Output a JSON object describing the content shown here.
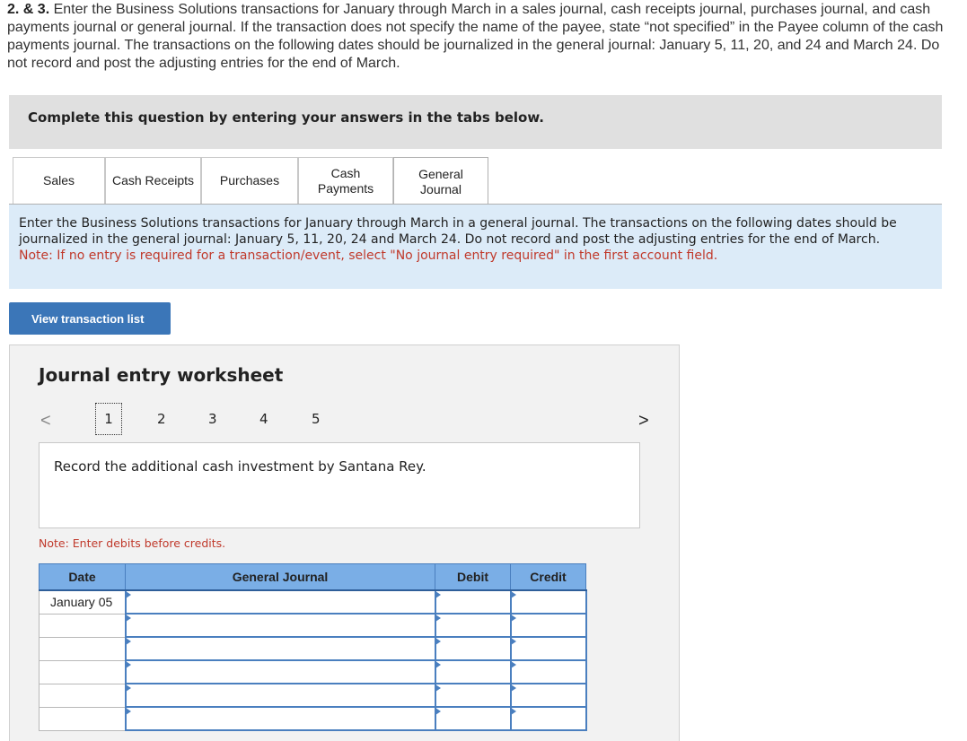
{
  "question": {
    "number": "2. & 3.",
    "text": "Enter the Business Solutions transactions for January through March in a sales journal, cash receipts journal, purchases journal, and cash payments journal or general journal. If the transaction does not specify the name of the payee, state “not specified” in the Payee column of the cash payments journal. The transactions on the following dates should be journalized in the general journal: January 5, 11, 20, and 24 and March 24. Do not record and post the adjusting entries for the end of March."
  },
  "banner": "Complete this question by entering your answers in the tabs below.",
  "tabs": [
    {
      "label": "Sales"
    },
    {
      "label": "Cash Receipts"
    },
    {
      "label": "Purchases"
    },
    {
      "label": "Cash Payments"
    },
    {
      "label": "General Journal"
    }
  ],
  "instructions": {
    "text": "Enter the Business Solutions transactions for January through March in a general journal. The transactions on the following dates should be journalized in the general journal: January 5, 11, 20, 24 and March 24. Do not record and post the adjusting entries for the end of March.",
    "note": "Note: If no entry is required for a transaction/event, select \"No journal entry required\" in the first account field."
  },
  "view_button": "View transaction list",
  "worksheet": {
    "title": "Journal entry worksheet",
    "pages": [
      "1",
      "2",
      "3",
      "4",
      "5"
    ],
    "prev": "<",
    "next": ">",
    "description": "Record the additional cash investment by Santana Rey.",
    "note": "Note: Enter debits before credits.",
    "columns": [
      "Date",
      "General Journal",
      "Debit",
      "Credit"
    ],
    "rows": [
      {
        "date": "January 05"
      },
      {
        "date": ""
      },
      {
        "date": ""
      },
      {
        "date": ""
      },
      {
        "date": ""
      },
      {
        "date": ""
      }
    ]
  }
}
